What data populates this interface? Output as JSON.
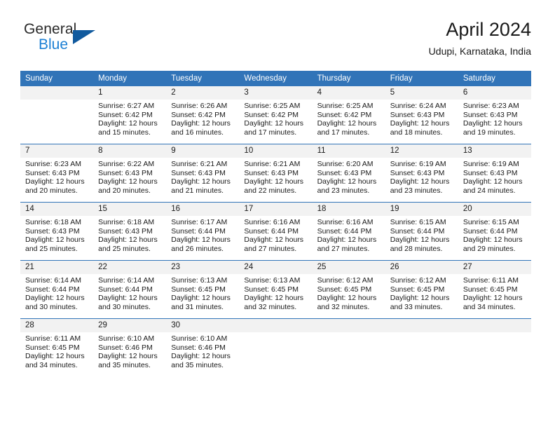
{
  "brand": {
    "name_part1": "General",
    "name_part2": "Blue",
    "triangle_color": "#115a9e",
    "blue_color": "#1b7fd4"
  },
  "header": {
    "title": "April 2024",
    "location": "Udupi, Karnataka, India"
  },
  "theme": {
    "header_blue": "#3174B8",
    "daynum_band": "#f2f2f2",
    "text": "#1a1a1a"
  },
  "calendar": {
    "weekday_headers": [
      "Sunday",
      "Monday",
      "Tuesday",
      "Wednesday",
      "Thursday",
      "Friday",
      "Saturday"
    ],
    "labels": {
      "sunrise": "Sunrise:",
      "sunset": "Sunset:",
      "daylight": "Daylight:"
    },
    "weeks": [
      [
        {
          "day": "",
          "empty": true
        },
        {
          "day": "1",
          "sunrise": "Sunrise: 6:27 AM",
          "sunset": "Sunset: 6:42 PM",
          "daylight_line1": "Daylight: 12 hours",
          "daylight_line2": "and 15 minutes."
        },
        {
          "day": "2",
          "sunrise": "Sunrise: 6:26 AM",
          "sunset": "Sunset: 6:42 PM",
          "daylight_line1": "Daylight: 12 hours",
          "daylight_line2": "and 16 minutes."
        },
        {
          "day": "3",
          "sunrise": "Sunrise: 6:25 AM",
          "sunset": "Sunset: 6:42 PM",
          "daylight_line1": "Daylight: 12 hours",
          "daylight_line2": "and 17 minutes."
        },
        {
          "day": "4",
          "sunrise": "Sunrise: 6:25 AM",
          "sunset": "Sunset: 6:42 PM",
          "daylight_line1": "Daylight: 12 hours",
          "daylight_line2": "and 17 minutes."
        },
        {
          "day": "5",
          "sunrise": "Sunrise: 6:24 AM",
          "sunset": "Sunset: 6:43 PM",
          "daylight_line1": "Daylight: 12 hours",
          "daylight_line2": "and 18 minutes."
        },
        {
          "day": "6",
          "sunrise": "Sunrise: 6:23 AM",
          "sunset": "Sunset: 6:43 PM",
          "daylight_line1": "Daylight: 12 hours",
          "daylight_line2": "and 19 minutes."
        }
      ],
      [
        {
          "day": "7",
          "sunrise": "Sunrise: 6:23 AM",
          "sunset": "Sunset: 6:43 PM",
          "daylight_line1": "Daylight: 12 hours",
          "daylight_line2": "and 20 minutes."
        },
        {
          "day": "8",
          "sunrise": "Sunrise: 6:22 AM",
          "sunset": "Sunset: 6:43 PM",
          "daylight_line1": "Daylight: 12 hours",
          "daylight_line2": "and 20 minutes."
        },
        {
          "day": "9",
          "sunrise": "Sunrise: 6:21 AM",
          "sunset": "Sunset: 6:43 PM",
          "daylight_line1": "Daylight: 12 hours",
          "daylight_line2": "and 21 minutes."
        },
        {
          "day": "10",
          "sunrise": "Sunrise: 6:21 AM",
          "sunset": "Sunset: 6:43 PM",
          "daylight_line1": "Daylight: 12 hours",
          "daylight_line2": "and 22 minutes."
        },
        {
          "day": "11",
          "sunrise": "Sunrise: 6:20 AM",
          "sunset": "Sunset: 6:43 PM",
          "daylight_line1": "Daylight: 12 hours",
          "daylight_line2": "and 23 minutes."
        },
        {
          "day": "12",
          "sunrise": "Sunrise: 6:19 AM",
          "sunset": "Sunset: 6:43 PM",
          "daylight_line1": "Daylight: 12 hours",
          "daylight_line2": "and 23 minutes."
        },
        {
          "day": "13",
          "sunrise": "Sunrise: 6:19 AM",
          "sunset": "Sunset: 6:43 PM",
          "daylight_line1": "Daylight: 12 hours",
          "daylight_line2": "and 24 minutes."
        }
      ],
      [
        {
          "day": "14",
          "sunrise": "Sunrise: 6:18 AM",
          "sunset": "Sunset: 6:43 PM",
          "daylight_line1": "Daylight: 12 hours",
          "daylight_line2": "and 25 minutes."
        },
        {
          "day": "15",
          "sunrise": "Sunrise: 6:18 AM",
          "sunset": "Sunset: 6:43 PM",
          "daylight_line1": "Daylight: 12 hours",
          "daylight_line2": "and 25 minutes."
        },
        {
          "day": "16",
          "sunrise": "Sunrise: 6:17 AM",
          "sunset": "Sunset: 6:44 PM",
          "daylight_line1": "Daylight: 12 hours",
          "daylight_line2": "and 26 minutes."
        },
        {
          "day": "17",
          "sunrise": "Sunrise: 6:16 AM",
          "sunset": "Sunset: 6:44 PM",
          "daylight_line1": "Daylight: 12 hours",
          "daylight_line2": "and 27 minutes."
        },
        {
          "day": "18",
          "sunrise": "Sunrise: 6:16 AM",
          "sunset": "Sunset: 6:44 PM",
          "daylight_line1": "Daylight: 12 hours",
          "daylight_line2": "and 27 minutes."
        },
        {
          "day": "19",
          "sunrise": "Sunrise: 6:15 AM",
          "sunset": "Sunset: 6:44 PM",
          "daylight_line1": "Daylight: 12 hours",
          "daylight_line2": "and 28 minutes."
        },
        {
          "day": "20",
          "sunrise": "Sunrise: 6:15 AM",
          "sunset": "Sunset: 6:44 PM",
          "daylight_line1": "Daylight: 12 hours",
          "daylight_line2": "and 29 minutes."
        }
      ],
      [
        {
          "day": "21",
          "sunrise": "Sunrise: 6:14 AM",
          "sunset": "Sunset: 6:44 PM",
          "daylight_line1": "Daylight: 12 hours",
          "daylight_line2": "and 30 minutes."
        },
        {
          "day": "22",
          "sunrise": "Sunrise: 6:14 AM",
          "sunset": "Sunset: 6:44 PM",
          "daylight_line1": "Daylight: 12 hours",
          "daylight_line2": "and 30 minutes."
        },
        {
          "day": "23",
          "sunrise": "Sunrise: 6:13 AM",
          "sunset": "Sunset: 6:45 PM",
          "daylight_line1": "Daylight: 12 hours",
          "daylight_line2": "and 31 minutes."
        },
        {
          "day": "24",
          "sunrise": "Sunrise: 6:13 AM",
          "sunset": "Sunset: 6:45 PM",
          "daylight_line1": "Daylight: 12 hours",
          "daylight_line2": "and 32 minutes."
        },
        {
          "day": "25",
          "sunrise": "Sunrise: 6:12 AM",
          "sunset": "Sunset: 6:45 PM",
          "daylight_line1": "Daylight: 12 hours",
          "daylight_line2": "and 32 minutes."
        },
        {
          "day": "26",
          "sunrise": "Sunrise: 6:12 AM",
          "sunset": "Sunset: 6:45 PM",
          "daylight_line1": "Daylight: 12 hours",
          "daylight_line2": "and 33 minutes."
        },
        {
          "day": "27",
          "sunrise": "Sunrise: 6:11 AM",
          "sunset": "Sunset: 6:45 PM",
          "daylight_line1": "Daylight: 12 hours",
          "daylight_line2": "and 34 minutes."
        }
      ],
      [
        {
          "day": "28",
          "sunrise": "Sunrise: 6:11 AM",
          "sunset": "Sunset: 6:45 PM",
          "daylight_line1": "Daylight: 12 hours",
          "daylight_line2": "and 34 minutes."
        },
        {
          "day": "29",
          "sunrise": "Sunrise: 6:10 AM",
          "sunset": "Sunset: 6:46 PM",
          "daylight_line1": "Daylight: 12 hours",
          "daylight_line2": "and 35 minutes."
        },
        {
          "day": "30",
          "sunrise": "Sunrise: 6:10 AM",
          "sunset": "Sunset: 6:46 PM",
          "daylight_line1": "Daylight: 12 hours",
          "daylight_line2": "and 35 minutes."
        },
        {
          "day": "",
          "empty": true
        },
        {
          "day": "",
          "empty": true
        },
        {
          "day": "",
          "empty": true
        },
        {
          "day": "",
          "empty": true
        }
      ]
    ]
  }
}
